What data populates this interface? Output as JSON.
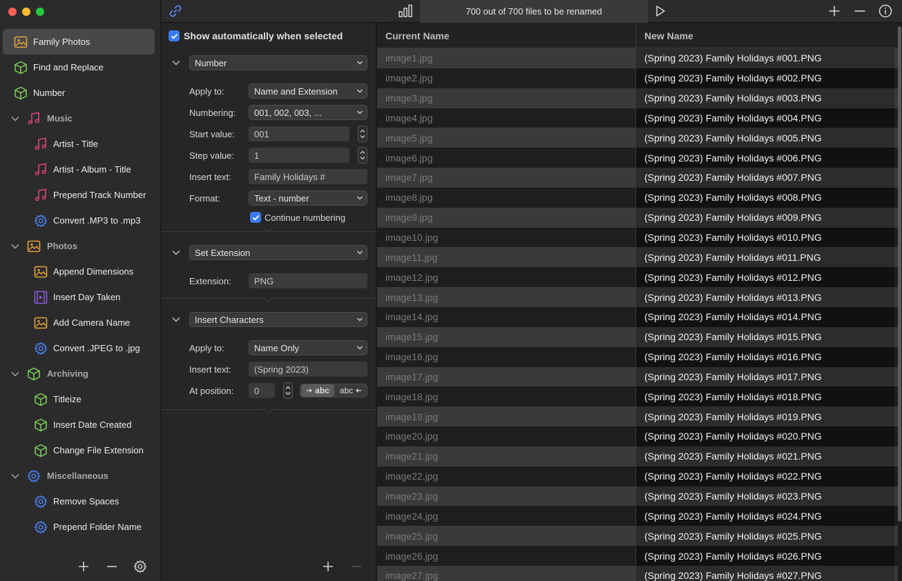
{
  "colors": {
    "accent": "#3a7bf3",
    "music": "#e0447f",
    "photos": "#e8a33b",
    "archiving": "#7fd35a",
    "misc": "#4a82f0",
    "video": "#8a5bd6"
  },
  "sidebar": {
    "items": [
      {
        "label": "Family Photos",
        "icon": "photo-icon"
      },
      {
        "label": "Find and Replace",
        "icon": "cube-icon"
      },
      {
        "label": "Number",
        "icon": "cube-icon"
      },
      {
        "label": "Music",
        "icon": "music-note-icon"
      },
      {
        "label": "Artist - Title",
        "icon": "music-note-icon"
      },
      {
        "label": "Artist - Album - Title",
        "icon": "music-note-icon"
      },
      {
        "label": "Prepend Track Number",
        "icon": "music-note-icon"
      },
      {
        "label": "Convert .MP3 to .mp3",
        "icon": "gear-icon"
      },
      {
        "label": "Photos",
        "icon": "photo-icon"
      },
      {
        "label": "Append Dimensions",
        "icon": "photo-icon"
      },
      {
        "label": "Insert Day Taken",
        "icon": "film-icon"
      },
      {
        "label": "Add Camera Name",
        "icon": "photo-icon"
      },
      {
        "label": "Convert .JPEG to .jpg",
        "icon": "gear-icon"
      },
      {
        "label": "Archiving",
        "icon": "cube-icon"
      },
      {
        "label": "Titleize",
        "icon": "cube-icon"
      },
      {
        "label": "Insert Date Created",
        "icon": "cube-icon"
      },
      {
        "label": "Change File Extension",
        "icon": "cube-icon"
      },
      {
        "label": "Miscellaneous",
        "icon": "gear-icon"
      },
      {
        "label": "Remove Spaces",
        "icon": "gear-icon"
      },
      {
        "label": "Prepend Folder Name",
        "icon": "gear-icon"
      }
    ]
  },
  "toolbar": {
    "status": "700 out of 700 files to be renamed"
  },
  "options": {
    "show_auto_label": "Show automatically when selected",
    "number": {
      "action": "Number",
      "apply_to_label": "Apply to:",
      "apply_to_value": "Name and Extension",
      "numbering_label": "Numbering:",
      "numbering_value": "001, 002, 003, ...",
      "start_label": "Start value:",
      "start_value": "001",
      "step_label": "Step value:",
      "step_value": "1",
      "insert_label": "Insert text:",
      "insert_value": "Family Holidays #",
      "format_label": "Format:",
      "format_value": "Text - number",
      "continue_label": "Continue numbering"
    },
    "extension": {
      "action": "Set Extension",
      "ext_label": "Extension:",
      "ext_value": "PNG"
    },
    "insert": {
      "action": "Insert Characters",
      "apply_to_label": "Apply to:",
      "apply_to_value": "Name Only",
      "insert_label": "Insert text:",
      "insert_value": "(Spring 2023)",
      "position_label": "At position:",
      "position_value": "0",
      "seg_left": "abc",
      "seg_right": "abc"
    }
  },
  "table": {
    "col_current": "Current Name",
    "col_new": "New Name",
    "rows": [
      [
        "image1.jpg",
        "(Spring 2023) Family Holidays #001.PNG"
      ],
      [
        "image2.jpg",
        "(Spring 2023) Family Holidays #002.PNG"
      ],
      [
        "image3.jpg",
        "(Spring 2023) Family Holidays #003.PNG"
      ],
      [
        "image4.jpg",
        "(Spring 2023) Family Holidays #004.PNG"
      ],
      [
        "image5.jpg",
        "(Spring 2023) Family Holidays #005.PNG"
      ],
      [
        "image6.jpg",
        "(Spring 2023) Family Holidays #006.PNG"
      ],
      [
        "image7.jpg",
        "(Spring 2023) Family Holidays #007.PNG"
      ],
      [
        "image8.jpg",
        "(Spring 2023) Family Holidays #008.PNG"
      ],
      [
        "image9.jpg",
        "(Spring 2023) Family Holidays #009.PNG"
      ],
      [
        "image10.jpg",
        "(Spring 2023) Family Holidays #010.PNG"
      ],
      [
        "image11.jpg",
        "(Spring 2023) Family Holidays #011.PNG"
      ],
      [
        "image12.jpg",
        "(Spring 2023) Family Holidays #012.PNG"
      ],
      [
        "image13.jpg",
        "(Spring 2023) Family Holidays #013.PNG"
      ],
      [
        "image14.jpg",
        "(Spring 2023) Family Holidays #014.PNG"
      ],
      [
        "image15.jpg",
        "(Spring 2023) Family Holidays #015.PNG"
      ],
      [
        "image16.jpg",
        "(Spring 2023) Family Holidays #016.PNG"
      ],
      [
        "image17.jpg",
        "(Spring 2023) Family Holidays #017.PNG"
      ],
      [
        "image18.jpg",
        "(Spring 2023) Family Holidays #018.PNG"
      ],
      [
        "image19.jpg",
        "(Spring 2023) Family Holidays #019.PNG"
      ],
      [
        "image20.jpg",
        "(Spring 2023) Family Holidays #020.PNG"
      ],
      [
        "image21.jpg",
        "(Spring 2023) Family Holidays #021.PNG"
      ],
      [
        "image22.jpg",
        "(Spring 2023) Family Holidays #022.PNG"
      ],
      [
        "image23.jpg",
        "(Spring 2023) Family Holidays #023.PNG"
      ],
      [
        "image24.jpg",
        "(Spring 2023) Family Holidays #024.PNG"
      ],
      [
        "image25.jpg",
        "(Spring 2023) Family Holidays #025.PNG"
      ],
      [
        "image26.jpg",
        "(Spring 2023) Family Holidays #026.PNG"
      ],
      [
        "image27.jpg",
        "(Spring 2023) Family Holidays #027.PNG"
      ]
    ]
  }
}
